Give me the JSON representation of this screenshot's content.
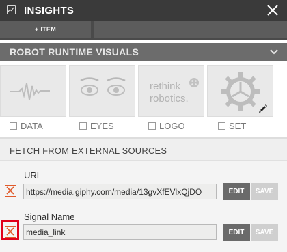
{
  "window": {
    "title": "INSIGHTS",
    "icon": "chart-window-icon"
  },
  "toolbar": {
    "add_item_label": "+ ITEM"
  },
  "runtime_visuals": {
    "title": "ROBOT RUNTIME VISUALS",
    "tiles": [
      {
        "label": "DATA",
        "icon": "waveform-icon"
      },
      {
        "label": "EYES",
        "icon": "eyes-icon"
      },
      {
        "label": "LOGO",
        "icon": "rethink-robotics-logo",
        "logo_text_1": "rethink",
        "logo_text_2": "robotics."
      },
      {
        "label": "SET",
        "icon": "gear-icon"
      }
    ]
  },
  "external_sources": {
    "title": "FETCH FROM EXTERNAL SOURCES",
    "fields": [
      {
        "label": "URL",
        "value": "https://media.giphy.com/media/13gvXfEVlxQjDO",
        "edit_label": "EDIT",
        "save_label": "SAVE"
      },
      {
        "label": "Signal Name",
        "value": "media_link",
        "edit_label": "EDIT",
        "save_label": "SAVE"
      }
    ]
  },
  "colors": {
    "accent_remove": "#e05a2a",
    "highlight": "#e0001b",
    "titlebar": "#3a3a3a"
  }
}
